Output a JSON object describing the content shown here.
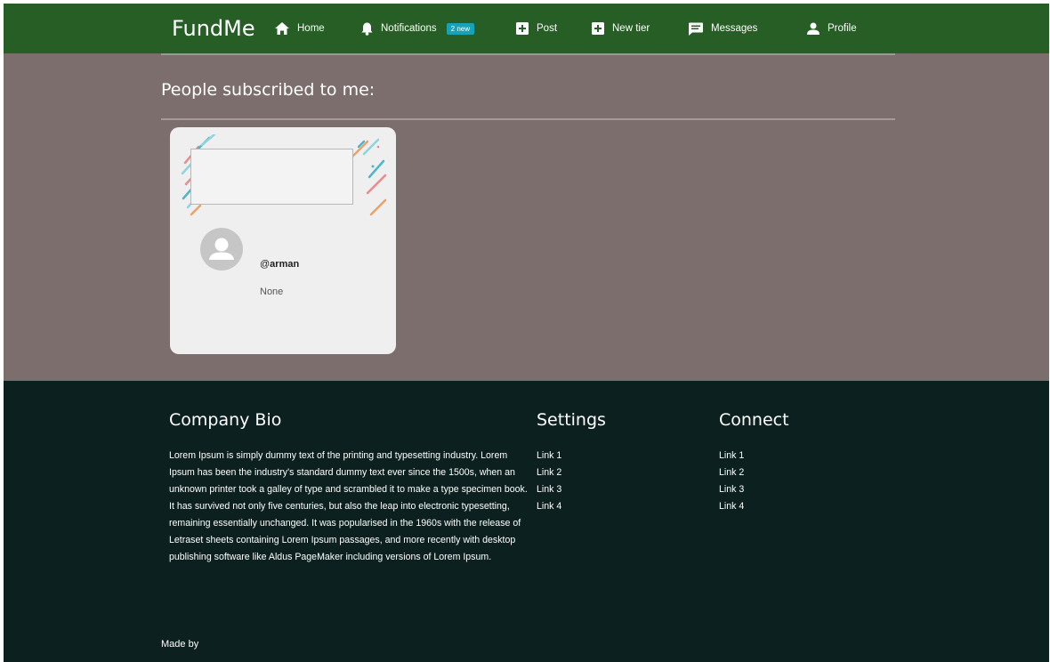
{
  "navbar": {
    "brand": "FundMe",
    "items": [
      {
        "label": "Home",
        "icon": "home-icon"
      },
      {
        "label": "Notifications",
        "icon": "bell-icon",
        "badge": "2 new"
      },
      {
        "label": "Post",
        "icon": "plus-box-icon"
      },
      {
        "label": "New tier",
        "icon": "plus-box-icon"
      },
      {
        "label": "Messages",
        "icon": "message-icon"
      },
      {
        "label": "Profile",
        "icon": "person-icon"
      }
    ],
    "colors": {
      "bar": "#275e26",
      "badge": "#17a2b8"
    }
  },
  "main": {
    "title": "People subscribed to me:",
    "background": "#7b6e6c",
    "subscribers": [
      {
        "handle_prefix": "@",
        "handle": "arman",
        "bio": "None"
      }
    ]
  },
  "footer": {
    "background": "#0b201f",
    "bio_heading": "Company Bio",
    "bio_text": "Lorem Ipsum is simply dummy text of the printing and typesetting industry. Lorem Ipsum has been the industry's standard dummy text ever since the 1500s, when an unknown printer took a galley of type and scrambled it to make a type specimen book. It has survived not only five centuries, but also the leap into electronic typesetting, remaining essentially unchanged. It was popularised in the 1960s with the release of Letraset sheets containing Lorem Ipsum passages, and more recently with desktop publishing software like Aldus PageMaker including versions of Lorem Ipsum.",
    "settings_heading": "Settings",
    "settings_links": [
      "Link 1",
      "Link 2",
      "Link 3",
      "Link 4"
    ],
    "connect_heading": "Connect",
    "connect_links": [
      "Link 1",
      "Link 2",
      "Link 3",
      "Link 4"
    ],
    "made_by": "Made by"
  }
}
